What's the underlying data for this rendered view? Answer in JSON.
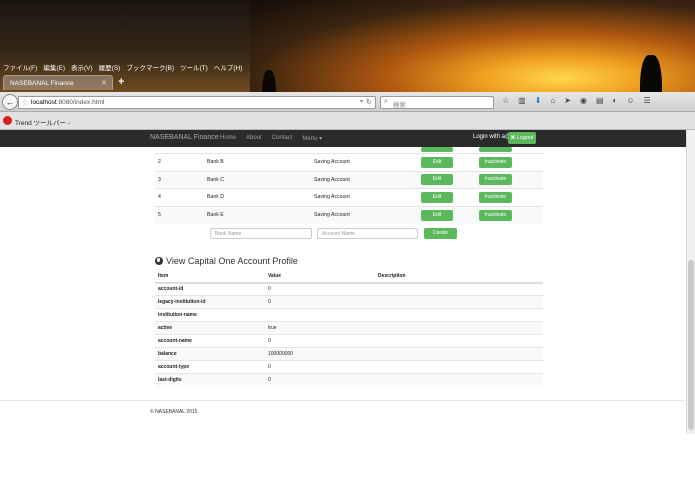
{
  "browser": {
    "menu": [
      "ファイル(F)",
      "編集(E)",
      "表示(V)",
      "履歴(S)",
      "ブックマーク(B)",
      "ツール(T)",
      "ヘルプ(H)"
    ],
    "tab_title": "NASEBANAL Finance",
    "url_host": "localhost",
    "url_rest": ":8080/index.html",
    "search_placeholder": "検索",
    "bookmark_label": "Trend ツールバー -"
  },
  "app": {
    "brand": "NASEBANAL Finance",
    "nav": [
      "Home",
      "About",
      "Contact",
      "Menu ▾"
    ],
    "login_text": "Login with a@a",
    "logout_label": "✖ Logout"
  },
  "banks": {
    "edit_label": "Edit",
    "inactivate_label": "Inactivate",
    "rows": [
      {
        "id": "2",
        "name": "Bank B",
        "account": "Saving Account"
      },
      {
        "id": "3",
        "name": "Bank C",
        "account": "Saving Account"
      },
      {
        "id": "4",
        "name": "Bank D",
        "account": "Saving Account"
      },
      {
        "id": "5",
        "name": "Bank E",
        "account": "Saving Account"
      }
    ],
    "bank_name_placeholder": "Bank Name",
    "account_name_placeholder": "Account Name",
    "create_label": "Create"
  },
  "profile": {
    "title": "View Capital One Account Profile",
    "headers": [
      "Item",
      "Value",
      "Description"
    ],
    "rows": [
      {
        "item": "account-id",
        "value": "0"
      },
      {
        "item": "legacy-institution-id",
        "value": "0"
      },
      {
        "item": "institution-name",
        "value": ""
      },
      {
        "item": "active",
        "value": "true"
      },
      {
        "item": "account-name",
        "value": "0"
      },
      {
        "item": "balance",
        "value": "100000000"
      },
      {
        "item": "account-type",
        "value": "0"
      },
      {
        "item": "last-digits",
        "value": "0"
      }
    ]
  },
  "footer": "© NASEBANAL 2015"
}
